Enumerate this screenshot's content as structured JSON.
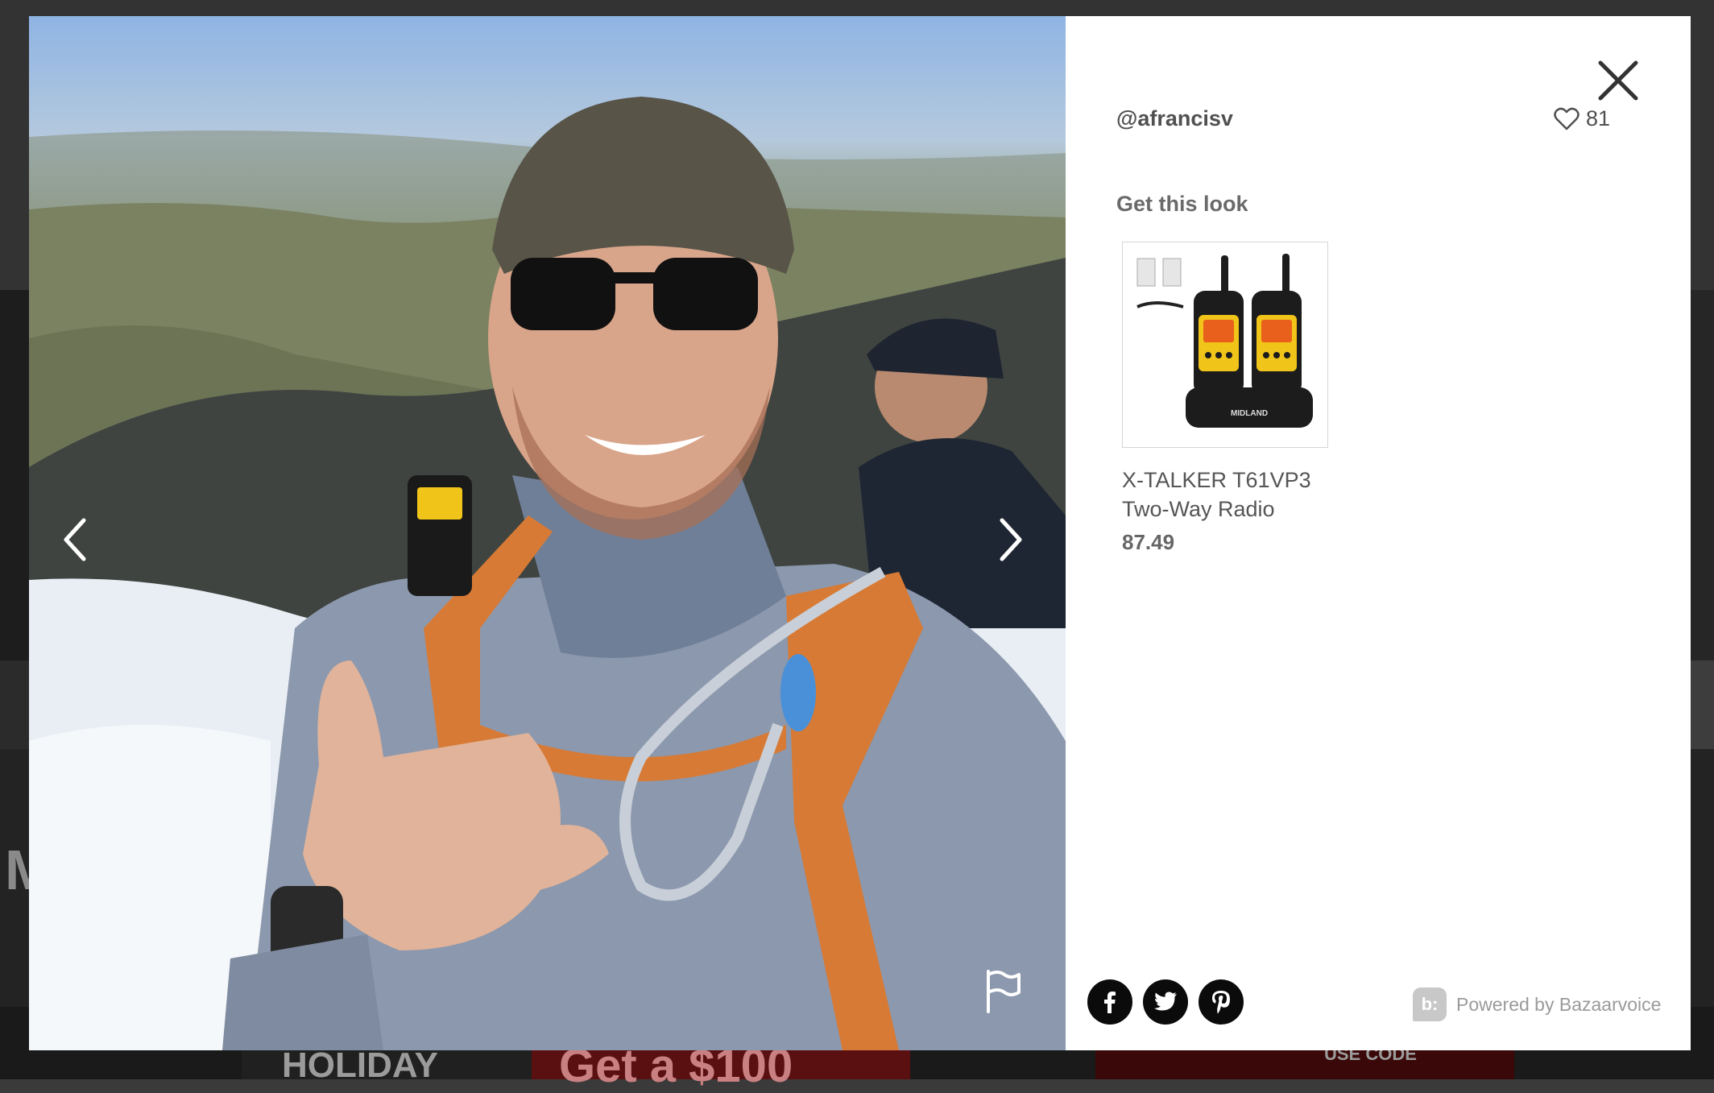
{
  "modal": {
    "username": "@afrancisv",
    "likes": "81",
    "section_title": "Get this look",
    "product": {
      "name_line1": "X-TALKER T61VP3",
      "name_line2": "Two-Way Radio",
      "price": "87.49",
      "brand_mark": "MIDLAND"
    },
    "footer": {
      "powered_logo": "b:",
      "powered_text": "Powered by Bazaarvoice"
    },
    "icons": {
      "close": "close-icon",
      "heart": "heart-icon",
      "prev": "chevron-left-icon",
      "next": "chevron-right-icon",
      "flag": "flag-icon",
      "facebook": "facebook-icon",
      "twitter": "twitter-icon",
      "pinterest": "pinterest-icon"
    }
  },
  "background": {
    "banner_left": "HOLIDAY",
    "banner_mid": "Get a $100",
    "banner_right": "USE CODE",
    "left_text": "M"
  },
  "colors": {
    "overlay": "#3a3a3a",
    "panel": "#ffffff",
    "social_button": "#0b0b0b",
    "radio_yellow": "#f0c419"
  }
}
